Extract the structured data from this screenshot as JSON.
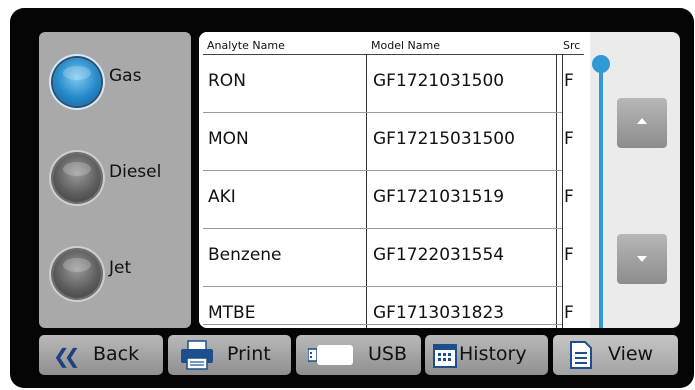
{
  "fuel_types": [
    {
      "label": "Gas",
      "selected": true
    },
    {
      "label": "Diesel",
      "selected": false
    },
    {
      "label": "Jet",
      "selected": false
    }
  ],
  "table": {
    "headers": {
      "analyte": "Analyte Name",
      "model": "Model Name",
      "src": "Src"
    },
    "rows": [
      {
        "analyte": "RON",
        "model": "GF1721031500",
        "src": "F"
      },
      {
        "analyte": "MON",
        "model": "GF17215031500",
        "src": "F"
      },
      {
        "analyte": "AKI",
        "model": "GF1721031519",
        "src": "F"
      },
      {
        "analyte": "Benzene",
        "model": "GF1722031554",
        "src": "F"
      },
      {
        "analyte": "MTBE",
        "model": "GF1713031823",
        "src": "F"
      }
    ]
  },
  "scroll": {
    "up_icon": "triangle-up-icon",
    "down_icon": "triangle-down-icon",
    "position_fraction": 0
  },
  "toolbar": {
    "back_label": "Back",
    "print_label": "Print",
    "usb_label": "USB",
    "history_label": "History",
    "view_label": "View"
  },
  "colors": {
    "accent_blue": "#2f98d6",
    "selected_radio": "#2489c9",
    "panel_gray": "#a9a9a9",
    "button_gray": "#a4a4a4",
    "bezel": "#050505"
  }
}
